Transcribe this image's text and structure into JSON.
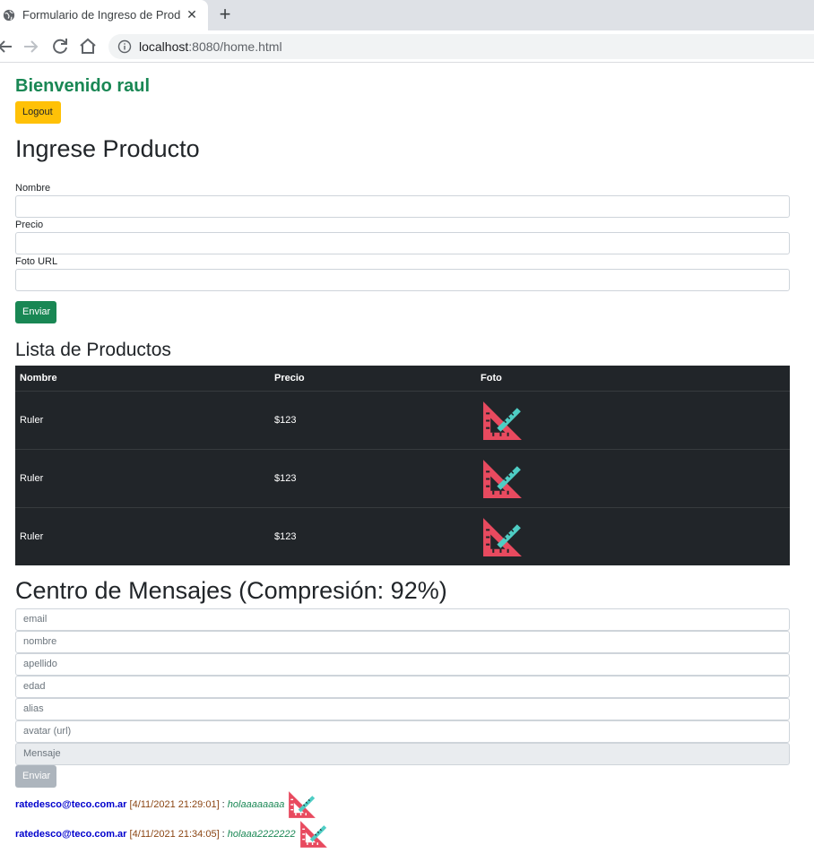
{
  "browser": {
    "tab_title": "Formulario de Ingreso de Produc",
    "new_tab": "+",
    "close": "✕",
    "url_host": "localhost",
    "url_rest": ":8080/home.html"
  },
  "header": {
    "welcome": "Bienvenido raul",
    "logout_label": "Logout"
  },
  "product_form": {
    "title": "Ingrese Producto",
    "fields": [
      {
        "label": "Nombre",
        "value": ""
      },
      {
        "label": "Precio",
        "value": ""
      },
      {
        "label": "Foto URL",
        "value": ""
      }
    ],
    "submit_label": "Enviar"
  },
  "product_list": {
    "title": "Lista de Productos",
    "columns": [
      "Nombre",
      "Precio",
      "Foto"
    ],
    "rows": [
      {
        "nombre": "Ruler",
        "precio": "$123",
        "foto": "ruler-icon"
      },
      {
        "nombre": "Ruler",
        "precio": "$123",
        "foto": "ruler-icon"
      },
      {
        "nombre": "Ruler",
        "precio": "$123",
        "foto": "ruler-icon"
      }
    ]
  },
  "messages": {
    "title": "Centro de Mensajes (Compresión: 92%)",
    "placeholders": [
      "email",
      "nombre",
      "apellido",
      "edad",
      "alias",
      "avatar (url)",
      "Mensaje"
    ],
    "submit_label": "Enviar",
    "items": [
      {
        "email": "ratedesco@teco.com.ar",
        "date": "[4/11/2021 21:29:01]",
        "sep": " : ",
        "text": "holaaaaaaaa",
        "avatar": "ruler-icon"
      },
      {
        "email": "ratedesco@teco.com.ar",
        "date": "[4/11/2021 21:34:05]",
        "sep": " : ",
        "text": "holaaa2222222",
        "avatar": "ruler-icon"
      }
    ]
  },
  "colors": {
    "success": "#198754",
    "warning": "#ffc107",
    "table_dark": "#212529",
    "email_blue": "#0000cd",
    "date_brown": "#8b4513"
  }
}
